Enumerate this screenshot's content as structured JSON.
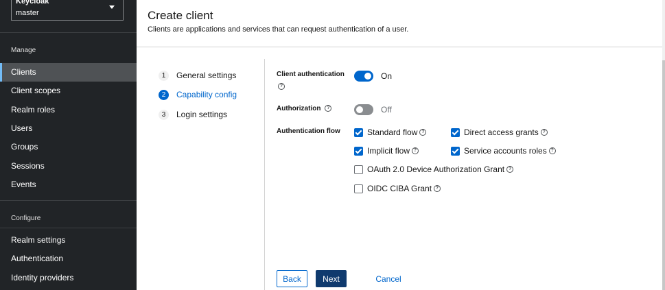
{
  "sidebar": {
    "realm_label": "Keycloak",
    "realm_value": "master",
    "sections": [
      {
        "title": "Manage",
        "items": [
          "Clients",
          "Client scopes",
          "Realm roles",
          "Users",
          "Groups",
          "Sessions",
          "Events"
        ]
      },
      {
        "title": "Configure",
        "items": [
          "Realm settings",
          "Authentication",
          "Identity providers"
        ]
      }
    ],
    "active_item": "Clients"
  },
  "header": {
    "title": "Create client",
    "subtitle": "Clients are applications and services that can request authentication of a user."
  },
  "wizard": {
    "steps": [
      {
        "number": "1",
        "label": "General settings"
      },
      {
        "number": "2",
        "label": "Capability config"
      },
      {
        "number": "3",
        "label": "Login settings"
      }
    ],
    "current_step": 2
  },
  "form": {
    "client_authentication": {
      "label": "Client authentication",
      "state": "On"
    },
    "authorization": {
      "label": "Authorization",
      "state": "Off"
    },
    "authentication_flow": {
      "label": "Authentication flow",
      "options": [
        {
          "label": "Standard flow",
          "checked": true
        },
        {
          "label": "Direct access grants",
          "checked": true
        },
        {
          "label": "Implicit flow",
          "checked": true
        },
        {
          "label": "Service accounts roles",
          "checked": true
        },
        {
          "label": "OAuth 2.0 Device Authorization Grant",
          "checked": false
        },
        {
          "label": "OIDC CIBA Grant",
          "checked": false
        }
      ]
    },
    "help_icon_glyph": "?"
  },
  "footer": {
    "back_label": "Back",
    "next_label": "Next",
    "cancel_label": "Cancel"
  },
  "colors": {
    "sidebar_bg": "#212427",
    "accent": "#0066cc",
    "primary_button": "#0f3a6e",
    "active_indicator": "#73bcf7"
  }
}
